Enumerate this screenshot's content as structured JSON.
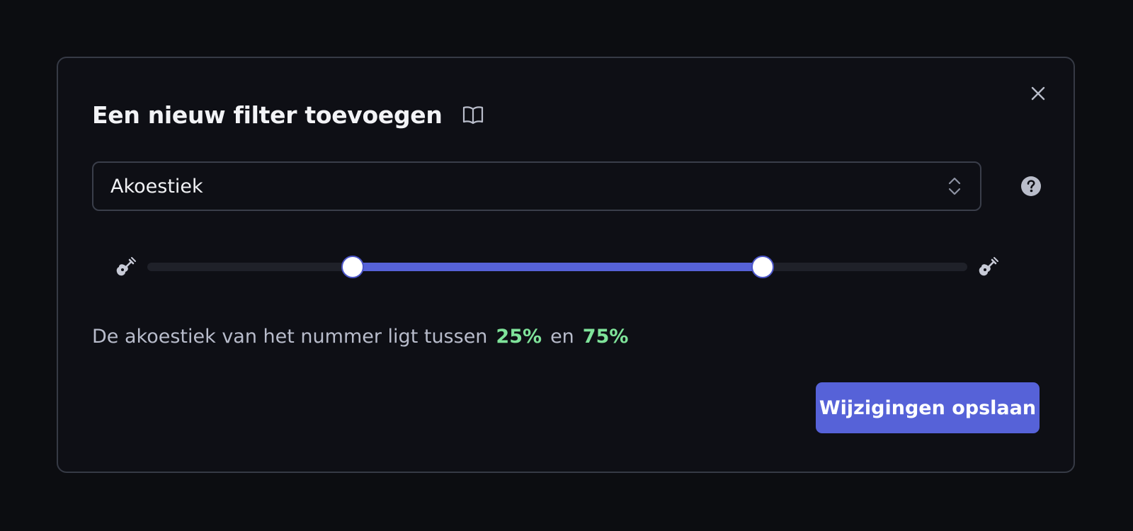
{
  "modal": {
    "title": "Een nieuw filter toevoegen",
    "title_icon": "book-open-icon",
    "close_icon": "close-icon"
  },
  "filter_select": {
    "value": "Akoestiek",
    "icon": "chevron-up-down-icon"
  },
  "help_icon": "question-circle-icon",
  "slider": {
    "min_icon": "guitar-icon",
    "max_icon": "guitar-icon",
    "low": 25,
    "high": 75,
    "min": 0,
    "max": 100,
    "track_color": "#1f2129",
    "range_color": "#5662d8"
  },
  "description": {
    "prefix": "De akoestiek van het nummer ligt tussen",
    "low_label": "25%",
    "connector": "en",
    "high_label": "75%",
    "accent_color": "#7fe39a"
  },
  "actions": {
    "save_label": "Wijzigingen opslaan",
    "save_color": "#5662d8"
  }
}
